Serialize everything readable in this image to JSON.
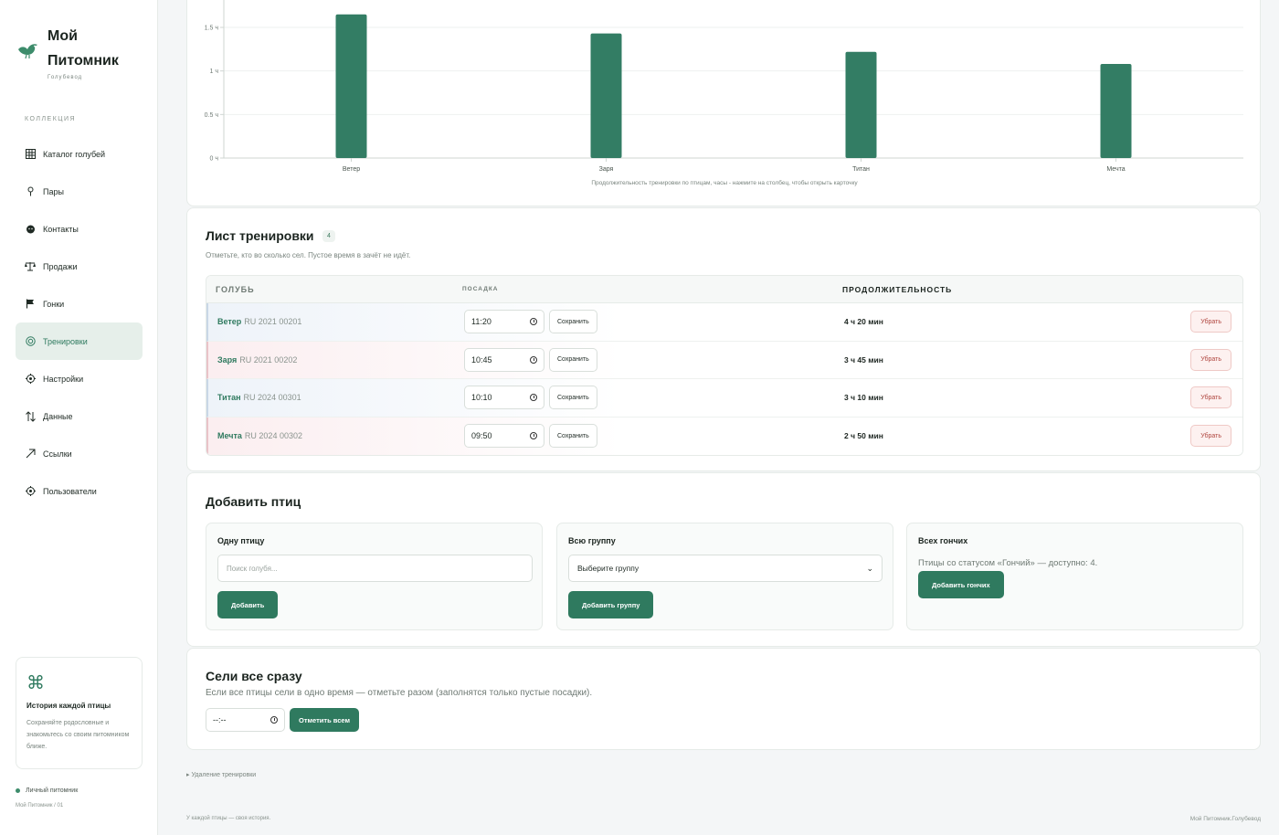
{
  "brand": {
    "title": "Мой Питомник",
    "subtitle": "Голубевод"
  },
  "sidebar": {
    "section_label": "КОЛЛЕКЦИЯ",
    "items": [
      {
        "label": "Каталог голубей",
        "icon": "grid-icon"
      },
      {
        "label": "Пары",
        "icon": "pin-icon"
      },
      {
        "label": "Контакты",
        "icon": "face-icon"
      },
      {
        "label": "Продажи",
        "icon": "scales-icon"
      },
      {
        "label": "Гонки",
        "icon": "flag-icon"
      },
      {
        "label": "Тренировки",
        "icon": "target-icon",
        "active": true
      },
      {
        "label": "Настройки",
        "icon": "gear-icon"
      },
      {
        "label": "Данные",
        "icon": "sort-arrows-icon"
      },
      {
        "label": "Ссылки",
        "icon": "link-arrow-icon"
      },
      {
        "label": "Пользователи",
        "icon": "gear-icon"
      }
    ],
    "promo": {
      "icon": "⌘",
      "title": "История каждой птицы",
      "text": "Сохраняйте родословные и знакомьтесь со своим питомником ближе."
    },
    "kennel_label": "Личный питомник",
    "kennel_sub": "Мой Питомник / 01"
  },
  "chart_data": {
    "type": "bar",
    "categories": [
      "Ветер",
      "Заря",
      "Титан",
      "Мечта"
    ],
    "values": [
      1.65,
      1.43,
      1.22,
      1.08
    ],
    "y_ticks": [
      "0 ч",
      "0.5 ч",
      "1 ч",
      "1.5 ч"
    ],
    "ylim": [
      0,
      1.5
    ],
    "caption": "Продолжительность тренировки по птицам, часы - нажмите на столбец, чтобы открыть карточку",
    "bar_color": "#337d64",
    "grid": true
  },
  "sheet": {
    "title": "Лист тренировки",
    "count": "4",
    "subtitle": "Отметьте, кто во сколько сел. Пустое время в зачёт не идёт.",
    "columns": {
      "bird": "ГОЛУБЬ",
      "landing": "ПОСАДКА",
      "duration": "ПРОДОЛЖИТЕЛЬНОСТЬ"
    },
    "save_label": "Сохранить",
    "remove_label": "Убрать",
    "rows": [
      {
        "name": "Ветер",
        "ring": "RU 2021 00201",
        "time": "11:20",
        "duration": "4 ч 20 мин"
      },
      {
        "name": "Заря",
        "ring": "RU 2021 00202",
        "time": "10:45",
        "duration": "3 ч 45 мин"
      },
      {
        "name": "Титан",
        "ring": "RU 2024 00301",
        "time": "10:10",
        "duration": "3 ч 10 мин"
      },
      {
        "name": "Мечта",
        "ring": "RU 2024 00302",
        "time": "09:50",
        "duration": "2 ч 50 мин"
      }
    ]
  },
  "add": {
    "title": "Добавить птиц",
    "single": {
      "title": "Одну птицу",
      "placeholder": "Поиск голубя...",
      "button": "Добавить"
    },
    "group": {
      "title": "Всю группу",
      "select_value": "Выберите группу",
      "button": "Добавить группу"
    },
    "hounds": {
      "title": "Всех гончих",
      "text": "Птицы со статусом «Гончий» — доступно: 4.",
      "button": "Добавить гончих"
    }
  },
  "all_at_once": {
    "title": "Сели все сразу",
    "subtitle": "Если все птицы сели в одно время — отметьте разом (заполнятся только пустые посадки).",
    "time_value": "--:--",
    "button": "Отметить всем"
  },
  "delete_details": "▸ Удаление тренировки",
  "footer": {
    "left": "У каждой птицы — своя история.",
    "right": "Мой Питомник.Голубевод"
  }
}
